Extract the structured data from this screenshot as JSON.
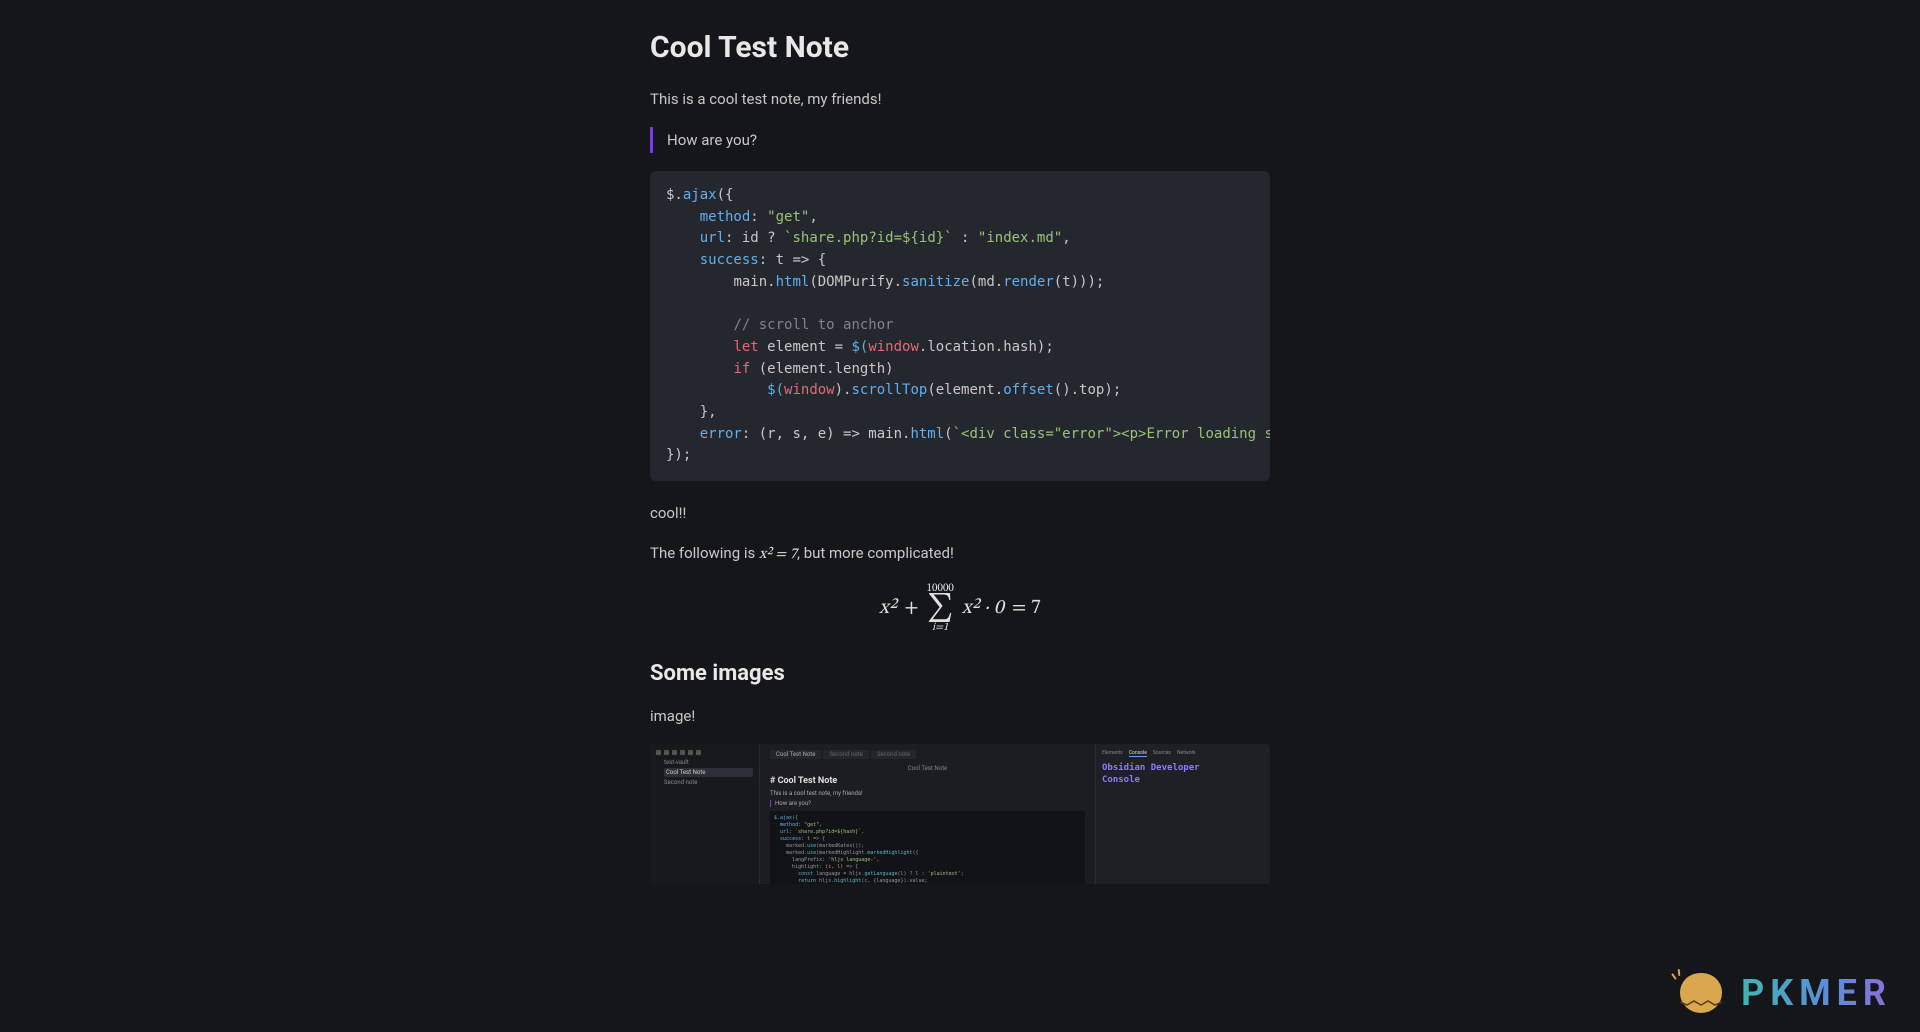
{
  "title": "Cool Test Note",
  "intro": "This is a cool test note, my friends!",
  "quote": "How are you?",
  "after_code": "cool!!",
  "math_sentence_prefix": "The following is ",
  "math_inline": "x² = 7",
  "math_sentence_suffix": ", but more complicated!",
  "math_display": {
    "left_term": "x²",
    "plus": "+",
    "sum_upper": "10000",
    "sum_lower": "i=1",
    "right_term": "x² · 0",
    "equals": "= 7"
  },
  "h2_images": "Some images",
  "image_caption": "image!",
  "code": {
    "l1a": "$.",
    "l1b": "ajax",
    "l1c": "({",
    "l2a": "method",
    "l2b": ": ",
    "l2c": "\"get\"",
    "l2d": ",",
    "l3a": "url",
    "l3b": ": id ? ",
    "l3c": "`share.php?id=${id}`",
    "l3d": " : ",
    "l3e": "\"index.md\"",
    "l3f": ",",
    "l4a": "success",
    "l4b": ": t => {",
    "l5a": "main.",
    "l5b": "html",
    "l5c": "(DOMPurify.",
    "l5d": "sanitize",
    "l5e": "(md.",
    "l5f": "render",
    "l5g": "(t)));",
    "l6": "// scroll to anchor",
    "l7a": "let",
    "l7b": " element = ",
    "l7c": "$",
    "l7d": "(",
    "l7e": "window",
    "l7f": ".location.hash);",
    "l8a": "if",
    "l8b": " (element.length)",
    "l9a": "$",
    "l9b": "(",
    "l9c": "window",
    "l9d": ").",
    "l9e": "scrollTop",
    "l9f": "(element.",
    "l9g": "offset",
    "l9h": "().top);",
    "l10": "},",
    "l11a": "error",
    "l11b": ": (r, s, e) => main.",
    "l11c": "html",
    "l11d": "(",
    "l11e": "`<div class=\"error\"><p>Error loading s",
    "l12": "});"
  },
  "embed": {
    "sidebar_items": [
      "test-vault",
      "Cool Test Note",
      "Second note"
    ],
    "tabs": [
      "Cool Test Note",
      "Second note",
      "Second note"
    ],
    "breadcrumb": "Cool Test Note",
    "title": "# Cool Test Note",
    "line1": "This is a cool test note, my friends!",
    "quote": "How are you?",
    "devtabs": [
      "Elements",
      "Console",
      "Sources",
      "Network"
    ],
    "console1": "Obsidian Developer",
    "console2": "Console"
  },
  "watermark": "PKMER"
}
